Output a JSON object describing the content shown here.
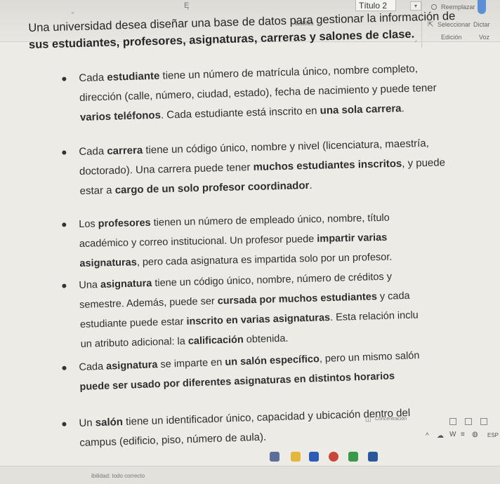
{
  "ribbon": {
    "style_label": "Título 2",
    "styles_group": "Estilos",
    "replace_label": "Reemplazar",
    "select_label": "Seleccionar",
    "editing_group": "Edición",
    "dictate_label": "Dictar",
    "voice_group": "Voz"
  },
  "document": {
    "intro_lines": [
      "Una universidad desea diseñar una base de datos para gestionar la información de",
      "sus estudiantes, profesores, asignaturas, carreras y salones de clase."
    ],
    "bullets": [
      {
        "lines": [
          [
            "Cada ",
            "estudiante",
            " tiene un número de matrícula único, nombre completo,"
          ],
          [
            "dirección (calle, número, ciudad, estado), fecha de nacimiento y puede tener"
          ],
          [
            "",
            "varios teléfonos",
            ". Cada estudiante está inscrito en ",
            "una sola carrera",
            "."
          ]
        ]
      },
      {
        "lines": [
          [
            "Cada ",
            "carrera",
            " tiene un código único, nombre y nivel (licenciatura, maestría,"
          ],
          [
            "doctorado). Una carrera puede tener ",
            "muchos estudiantes inscritos",
            ", y puede"
          ],
          [
            "estar a ",
            "cargo de un solo profesor coordinador",
            "."
          ]
        ]
      },
      {
        "lines": [
          [
            "Los ",
            "profesores",
            " tienen un número de empleado único, nombre, título"
          ],
          [
            "académico y correo institucional. Un profesor puede ",
            "impartir varias"
          ],
          [
            "",
            "asignaturas",
            ", pero cada asignatura es impartida solo por un profesor."
          ]
        ]
      },
      {
        "lines": [
          [
            "Una ",
            "asignatura",
            " tiene un código único, nombre, número de créditos y"
          ],
          [
            "semestre. Además, puede ser ",
            "cursada por muchos estudiantes",
            " y cada"
          ],
          [
            "estudiante puede estar ",
            "inscrito en varias asignaturas",
            ". Esta relación inclu"
          ],
          [
            "un atributo adicional: la ",
            "calificación",
            " obtenida."
          ]
        ]
      },
      {
        "lines": [
          [
            "Cada ",
            "asignatura",
            " se imparte en ",
            "un salón específico",
            ", pero un mismo salón"
          ],
          [
            "",
            "puede ser usado por diferentes asignaturas en distintos horarios"
          ]
        ]
      },
      {
        "lines": [
          [
            "Un ",
            "salón",
            " tiene un identificador único, capacidad y ubicación dentro del"
          ],
          [
            "campus (edificio, piso, número de aula)."
          ]
        ]
      }
    ]
  },
  "statusbar": {
    "accessibility": "ibilidad: todo correcto",
    "focus_label": "Concentración"
  },
  "colors": {
    "accent": "#5b8fd6",
    "page_bg": "#ecebe6"
  }
}
